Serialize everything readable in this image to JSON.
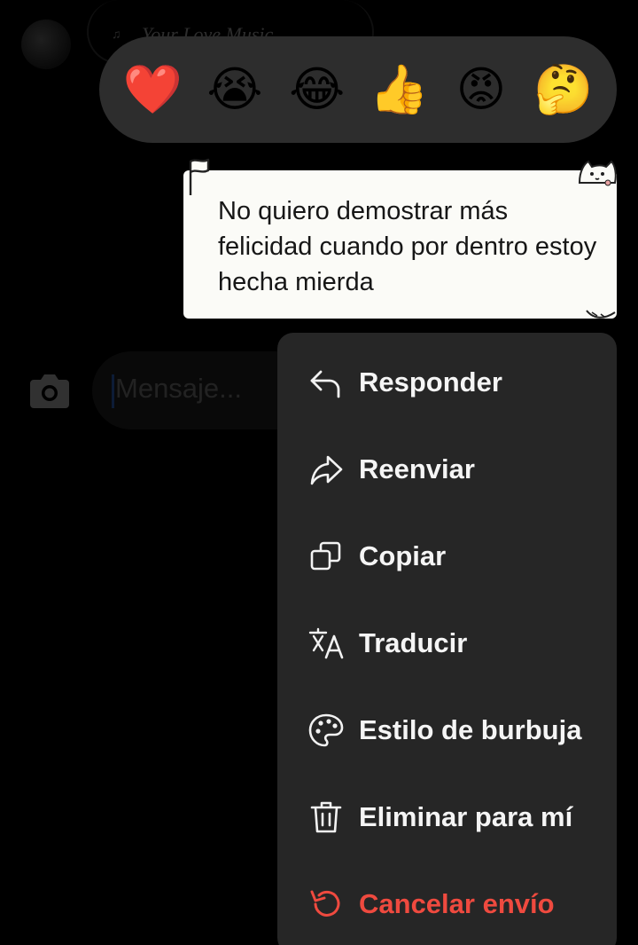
{
  "header": {
    "music_title": "Your Love Music"
  },
  "composer": {
    "placeholder": "Mensaje..."
  },
  "reactions": [
    {
      "emoji": "❤️",
      "icon": "red-heart"
    },
    {
      "emoji": "😭",
      "icon": "loudly-crying-face"
    },
    {
      "emoji": "😂",
      "icon": "face-with-tears-of-joy"
    },
    {
      "emoji": "👍",
      "icon": "thumbs-up"
    },
    {
      "emoji": "😡",
      "icon": "angry-face"
    },
    {
      "emoji": "🤔",
      "icon": "thinking-face"
    }
  ],
  "message": {
    "text": "No quiero demostrar más felicidad cuando por dentro estoy hecha mierda"
  },
  "menu": {
    "items": [
      {
        "label": "Responder",
        "icon": "reply-icon"
      },
      {
        "label": "Reenviar",
        "icon": "forward-icon"
      },
      {
        "label": "Copiar",
        "icon": "copy-icon"
      },
      {
        "label": "Traducir",
        "icon": "translate-icon"
      },
      {
        "label": "Estilo de burbuja",
        "icon": "palette-icon"
      },
      {
        "label": "Eliminar para mí",
        "icon": "trash-icon"
      },
      {
        "label": "Cancelar envío",
        "icon": "undo-icon"
      }
    ]
  },
  "colors": {
    "background": "#000000",
    "menu_bg": "#262626",
    "reaction_bar_bg": "#2d2d2d",
    "danger": "#ef4a3f",
    "bubble_bg": "#fbfbf7"
  }
}
